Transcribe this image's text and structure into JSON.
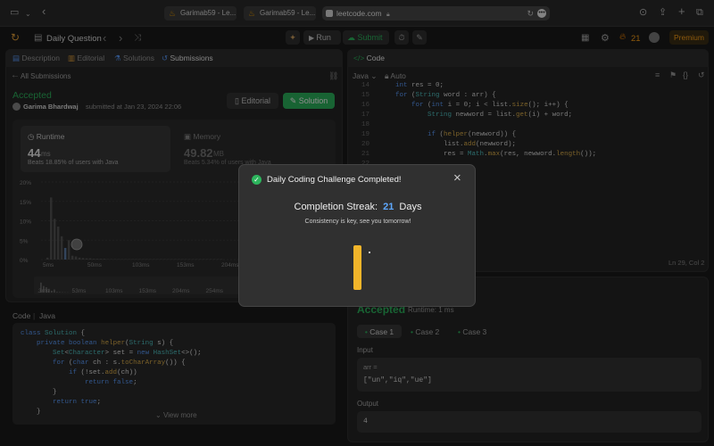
{
  "browser": {
    "tabs": [
      "Garimab59 - Le...",
      "Garimab59 - Le..."
    ],
    "url": "leetcode.com"
  },
  "toolbar": {
    "title": "Daily Question",
    "run_label": "Run",
    "submit_label": "Submit",
    "streak_count": "21",
    "premium_label": "Premium"
  },
  "left_tabs": [
    "Description",
    "Editorial",
    "Solutions",
    "Submissions"
  ],
  "submission": {
    "back_label": "All Submissions",
    "status": "Accepted",
    "user": "Garima Bhardwaj",
    "submitted_text": "submitted at Jan 23, 2024 22:06",
    "editorial_btn": "Editorial",
    "solution_btn": "Solution",
    "runtime_label": "Runtime",
    "runtime_value": "44",
    "runtime_unit": "ms",
    "runtime_beats": "Beats 18.85% of users with Java",
    "memory_label": "Memory",
    "memory_value": "49.82",
    "memory_unit": "MB",
    "memory_beats": "Beats 5.34% of users with Java"
  },
  "chart_data": {
    "type": "bar",
    "ylabel_ticks": [
      "20%",
      "15%",
      "10%",
      "5%",
      "0%"
    ],
    "x_ticks": [
      "5ms",
      "50ms",
      "103ms",
      "153ms",
      "204ms",
      "254ms"
    ],
    "mini_ticks": [
      "3ms",
      "53ms",
      "103ms",
      "153ms",
      "204ms",
      "254ms"
    ],
    "values": [
      0.5,
      16,
      10.5,
      8.5,
      6,
      3,
      5,
      1,
      0.8,
      0.5,
      0.4,
      0.3,
      0.3,
      0.2,
      0.2,
      0.2,
      0.2,
      0.1,
      0.1,
      0.1,
      0.1,
      0.1,
      0.1,
      0.1,
      0.1,
      0.1,
      0.1,
      0.1,
      0.1,
      0.1,
      0.1,
      0.1,
      0.1,
      0.1,
      0.1,
      0.1,
      0.1,
      0.1,
      0.1,
      0.1,
      0.1,
      0.1,
      0.1,
      0.1,
      0.1,
      0.1,
      0.1,
      0.1,
      0.1,
      0.1
    ],
    "ylim": [
      0,
      20
    ]
  },
  "code_section": {
    "label": "Code",
    "lang": "Java",
    "lines": [
      "class Solution {",
      "    private boolean helper(String s) {",
      "        Set<Character> set = new HashSet<>();",
      "        for (char ch : s.toCharArray()) {",
      "            if (!set.add(ch))",
      "                return false;",
      "        }",
      "        return true;",
      "    }"
    ],
    "view_more": "View more"
  },
  "editor": {
    "tab_label": "Code",
    "lang": "Java",
    "auto": "Auto",
    "line_numbers": [
      "14",
      "15",
      "16",
      "17",
      "18",
      "19",
      "20",
      "21",
      "22"
    ],
    "lines": [
      "    int res = 0;",
      "    for (String word : arr) {",
      "        for (int i = 0; i < list.size(); i++) {",
      "            String newword = list.get(i) + word;",
      "",
      "            if (helper(newword)) {",
      "                list.add(newword);",
      "                res = Math.max(res, newword.length());",
      ""
    ],
    "cursor_pos": "Ln 29, Col 2"
  },
  "testcases": {
    "result": "Accepted",
    "runtime": "Runtime: 1 ms",
    "cases": [
      "Case 1",
      "Case 2",
      "Case 3"
    ],
    "input_label": "Input",
    "arr_label": "arr =",
    "arr_value": "[\"un\",\"iq\",\"ue\"]",
    "output_label": "Output",
    "output_value": "4"
  },
  "modal": {
    "title": "Daily Coding Challenge Completed!",
    "streak_prefix": "Completion Streak:",
    "streak_value": "21",
    "streak_suffix": "Days",
    "subtitle": "Consistency is key, see you tomorrow!",
    "accent": "#2db55d",
    "streak_color": "#5ea8ff",
    "bar_color": "#f2b52a"
  }
}
